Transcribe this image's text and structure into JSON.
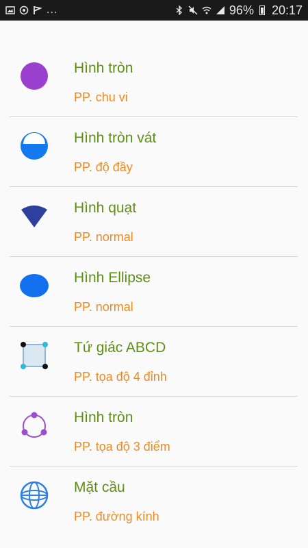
{
  "status_bar": {
    "overflow_dots": "...",
    "battery_percent": "96%",
    "time": "20:17"
  },
  "colors": {
    "title_text": "#5d8f14",
    "subtitle_text": "#ee8a22",
    "divider": "#d6d6d6"
  },
  "items": [
    {
      "title": "Hình tròn",
      "subtitle": "PP. chu vi",
      "icon": "purple-circle-icon"
    },
    {
      "title": "Hình tròn vát",
      "subtitle": "PP. độ đầy",
      "icon": "half-filled-circle-icon"
    },
    {
      "title": "Hình quạt",
      "subtitle": "PP. normal",
      "icon": "circular-sector-icon"
    },
    {
      "title": "Hình Ellipse",
      "subtitle": "PP. normal",
      "icon": "blue-ellipse-icon"
    },
    {
      "title": "Tứ giác ABCD",
      "subtitle": "PP. tọa độ 4 đỉnh",
      "icon": "quadrilateral-icon"
    },
    {
      "title": "Hình tròn",
      "subtitle": "PP. tọa độ 3 điểm",
      "icon": "three-point-circle-icon"
    },
    {
      "title": "Mặt cầu",
      "subtitle": "PP. đường kính",
      "icon": "sphere-icon"
    }
  ]
}
